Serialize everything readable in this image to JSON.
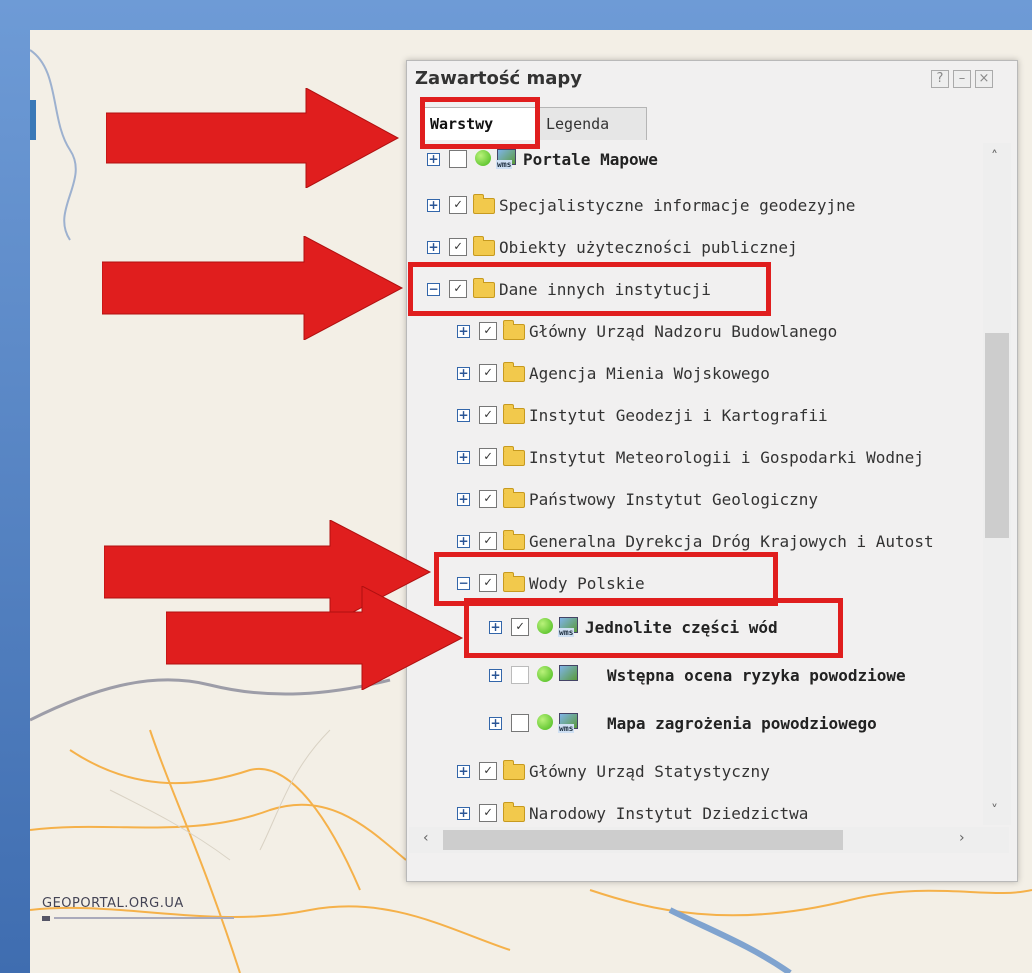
{
  "panel": {
    "title": "Zawartość mapy",
    "help_label": "?",
    "minimize_label": "–",
    "close_label": "×"
  },
  "tabs": [
    {
      "label": "Warstwy",
      "active": true
    },
    {
      "label": "Legenda",
      "active": false
    }
  ],
  "tree": [
    {
      "label": "Portale Mapowe",
      "expanded": false,
      "checked": false,
      "kind": "wms",
      "bold": true
    },
    {
      "label": "Specjalistyczne informacje geodezyjne",
      "expanded": false,
      "checked": true,
      "kind": "folder",
      "bold": false
    },
    {
      "label": "Obiekty użyteczności publicznej",
      "expanded": false,
      "checked": true,
      "kind": "folder",
      "bold": false
    },
    {
      "label": "Dane innych instytucji",
      "expanded": true,
      "checked": true,
      "kind": "folder",
      "bold": false
    },
    {
      "label": "Główny Urząd Nadzoru Budowlanego",
      "expanded": false,
      "checked": true,
      "kind": "folder",
      "bold": false
    },
    {
      "label": "Agencja Mienia Wojskowego",
      "expanded": false,
      "checked": true,
      "kind": "folder",
      "bold": false
    },
    {
      "label": "Instytut Geodezji i Kartografii",
      "expanded": false,
      "checked": true,
      "kind": "folder",
      "bold": false
    },
    {
      "label": "Instytut Meteorologii i Gospodarki Wodnej",
      "expanded": false,
      "checked": true,
      "kind": "folder",
      "bold": false
    },
    {
      "label": "Państwowy Instytut Geologiczny",
      "expanded": false,
      "checked": true,
      "kind": "folder",
      "bold": false
    },
    {
      "label": "Generalna Dyrekcja Dróg Krajowych i Autost",
      "expanded": false,
      "checked": true,
      "kind": "folder",
      "bold": false
    },
    {
      "label": "Wody Polskie",
      "expanded": true,
      "checked": true,
      "kind": "folder",
      "bold": false
    },
    {
      "label": "Jednolite części wód",
      "expanded": false,
      "checked": true,
      "kind": "wms",
      "bold": true
    },
    {
      "label": "Wstępna ocena ryzyka powodziowe",
      "expanded": false,
      "checked": false,
      "kind": "image",
      "bold": true
    },
    {
      "label": "Mapa zagrożenia powodziowego",
      "expanded": false,
      "checked": false,
      "kind": "wms",
      "bold": true
    },
    {
      "label": "Główny Urząd Statystyczny",
      "expanded": false,
      "checked": true,
      "kind": "folder",
      "bold": false
    },
    {
      "label": "Narodowy Instytut Dziedzictwa",
      "expanded": false,
      "checked": true,
      "kind": "folder",
      "bold": false
    }
  ],
  "layer_badge": "wms",
  "map": {
    "logo": "GEOPORTAL.ORG.UA"
  },
  "colors": {
    "highlight": "#e01e1e",
    "frame": "#4a78b8",
    "panel": "#f0f0f0"
  }
}
